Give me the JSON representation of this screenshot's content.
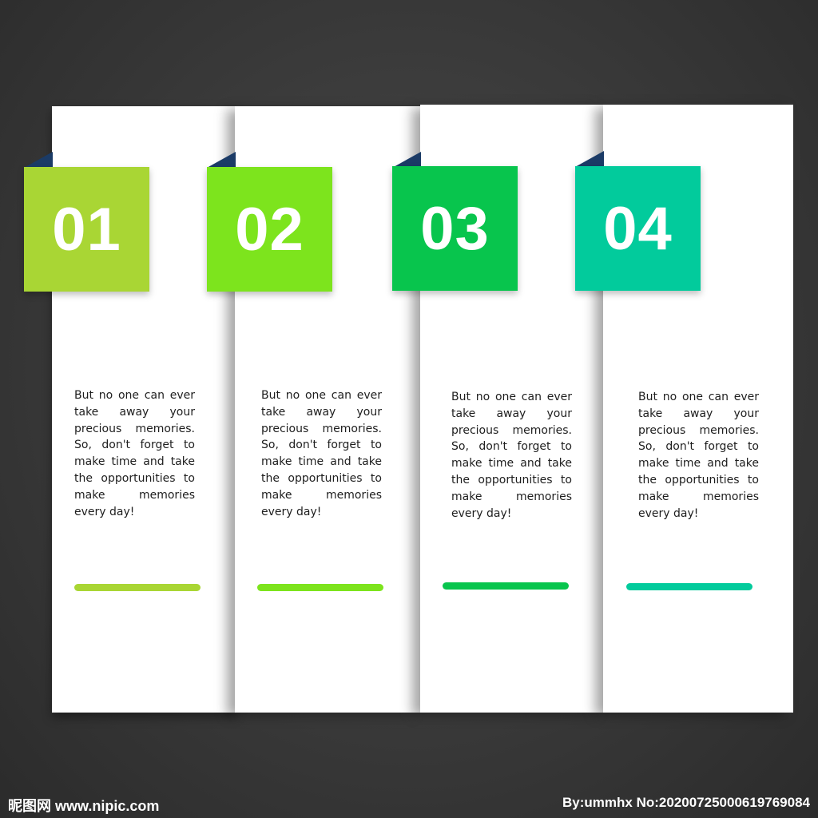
{
  "cards": [
    {
      "number": "01",
      "text": "But no one can ever take away your precious memories. So, don't forget to make time and take the opportunities to make memories every day!",
      "color": "#a9d634"
    },
    {
      "number": "02",
      "text": "But no one can ever take away your precious memories. So, don't forget to make time and take the opportunities to make memories every day!",
      "color": "#7de41d"
    },
    {
      "number": "03",
      "text": "But no one can ever take away your precious memories. So, don't forget to make time and take the opportunities to make memories every day!",
      "color": "#08c54d"
    },
    {
      "number": "04",
      "text": "But no one can ever take away your precious memories. So, don't forget to make time and take the opportunities to make memories every day!",
      "color": "#02cb9c"
    }
  ],
  "fold_color": "#1b3b66",
  "watermark": {
    "left": "昵图网 www.nipic.com",
    "right": "By:ummhx No:20200725000619769084"
  }
}
